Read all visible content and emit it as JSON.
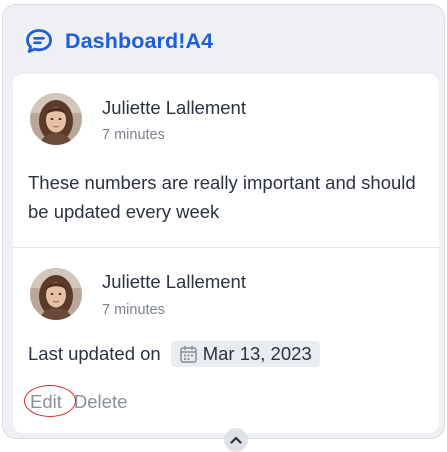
{
  "panel": {
    "title": "Dashboard!A4",
    "accent_color": "#1f5ed8",
    "icon": "chat-bubble-icon"
  },
  "comments": [
    {
      "author": "Juliette Lallement",
      "time": "7 minutes",
      "text": "These numbers are really important and should be updated every week"
    },
    {
      "author": "Juliette Lallement",
      "time": "7 minutes",
      "last_updated_label": "Last updated on",
      "date": "Mar 13, 2023",
      "actions": {
        "edit": "Edit",
        "delete": "Delete"
      }
    }
  ],
  "collapse_icon": "chevron-up-icon"
}
